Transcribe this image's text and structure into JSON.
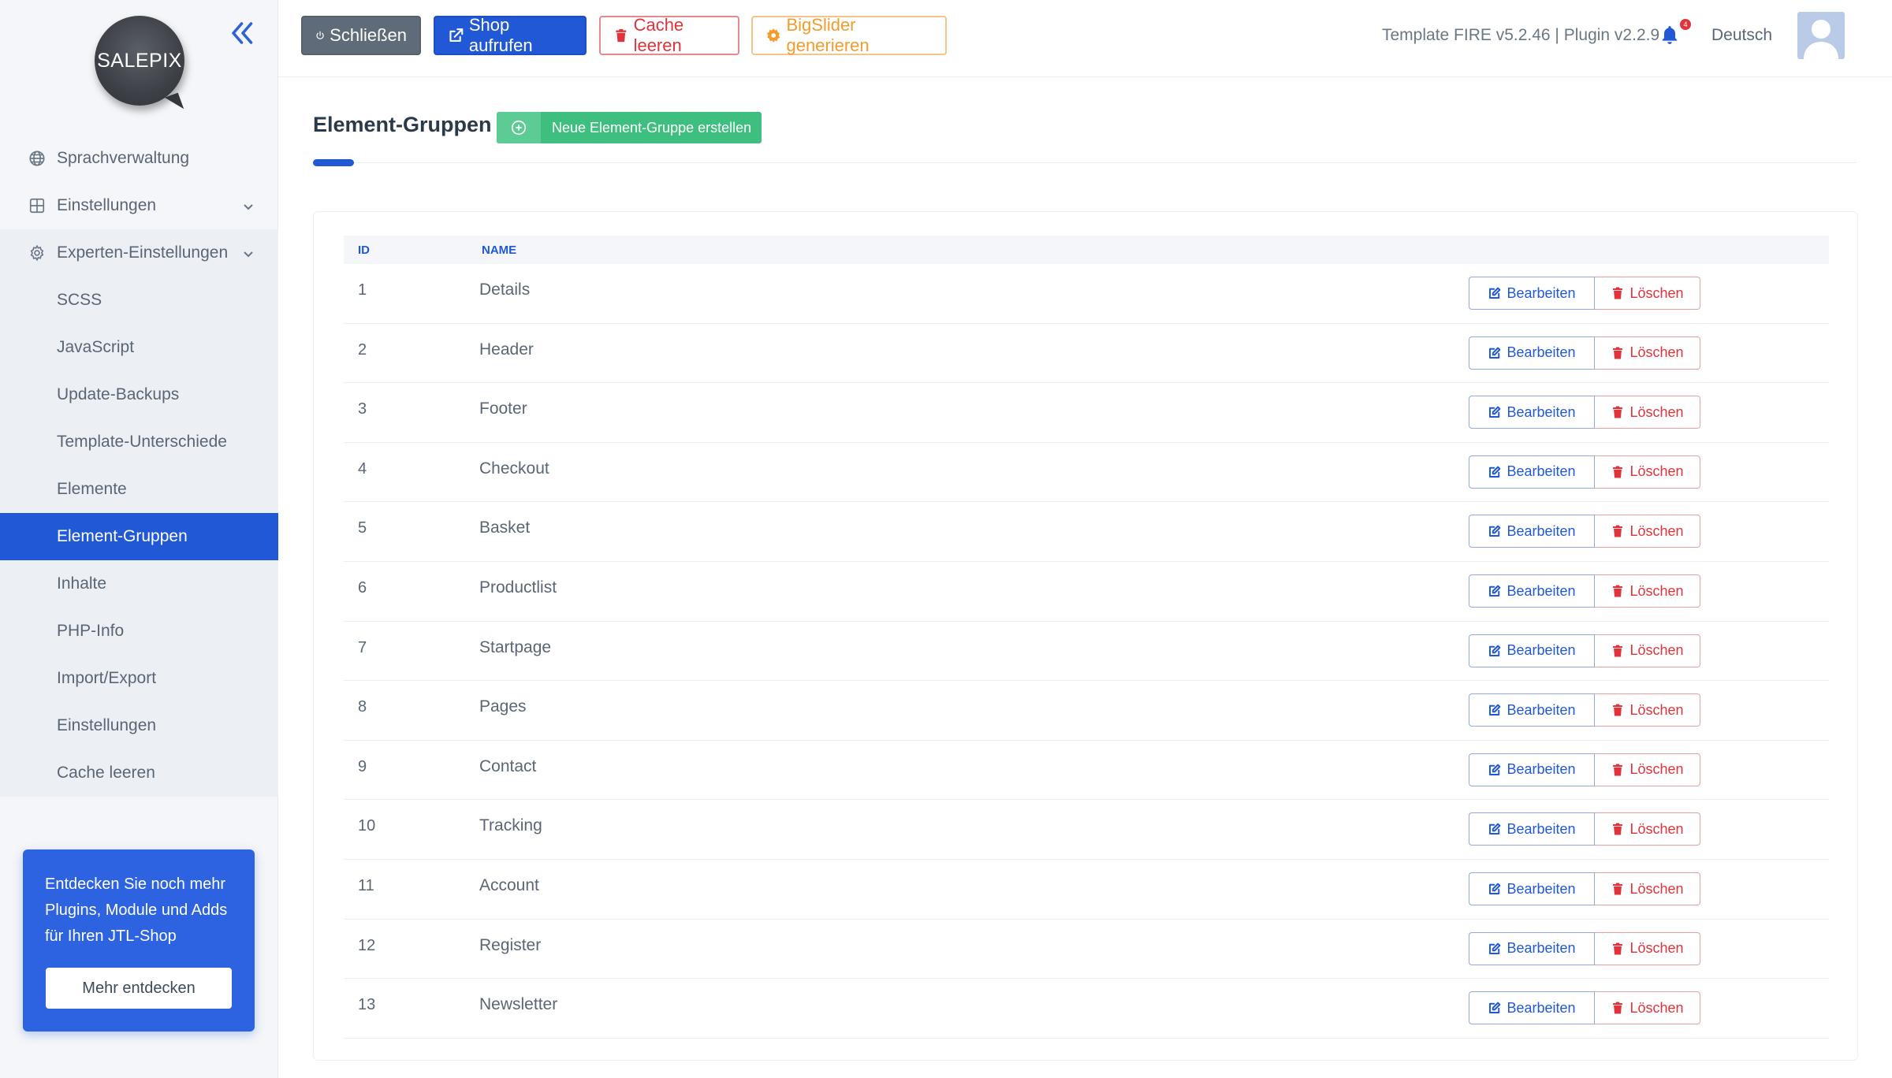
{
  "app": {
    "logo_text": "SALEPIX"
  },
  "sidebar": {
    "items": [
      {
        "label": "Sprachverwaltung",
        "icon": "globe-icon"
      },
      {
        "label": "Einstellungen",
        "icon": "grid-icon",
        "expandable": true
      },
      {
        "label": "Experten-Einstellungen",
        "icon": "gear-icon",
        "expandable": true,
        "expanded": true
      }
    ],
    "sub_items": [
      {
        "label": "SCSS"
      },
      {
        "label": "JavaScript"
      },
      {
        "label": "Update-Backups"
      },
      {
        "label": "Template-Unterschiede"
      },
      {
        "label": "Elemente"
      },
      {
        "label": "Element-Gruppen",
        "active": true
      },
      {
        "label": "Inhalte"
      },
      {
        "label": "PHP-Info"
      },
      {
        "label": "Import/Export"
      },
      {
        "label": "Einstellungen"
      },
      {
        "label": "Cache leeren"
      }
    ]
  },
  "promo": {
    "text": "Entdecken Sie noch mehr Plugins, Module und Adds für Ihren JTL-Shop",
    "button_label": "Mehr entdecken"
  },
  "topbar": {
    "close_label": "Schließen",
    "shop_label": "Shop aufrufen",
    "cache_label": "Cache leeren",
    "slider_label": "BigSlider generieren",
    "version": "Template FIRE v5.2.46 | Plugin v2.2.9",
    "notification_count": "4",
    "language": "Deutsch"
  },
  "main": {
    "title": "Element-Gruppen",
    "new_button_label": "Neue Element-Gruppe erstellen",
    "table": {
      "columns": [
        "ID",
        "NAME"
      ],
      "edit_label": "Bearbeiten",
      "delete_label": "Löschen",
      "rows": [
        {
          "id": "1",
          "name": "Details"
        },
        {
          "id": "2",
          "name": "Header"
        },
        {
          "id": "3",
          "name": "Footer"
        },
        {
          "id": "4",
          "name": "Checkout"
        },
        {
          "id": "5",
          "name": "Basket"
        },
        {
          "id": "6",
          "name": "Productlist"
        },
        {
          "id": "7",
          "name": "Startpage"
        },
        {
          "id": "8",
          "name": "Pages"
        },
        {
          "id": "9",
          "name": "Contact"
        },
        {
          "id": "10",
          "name": "Tracking"
        },
        {
          "id": "11",
          "name": "Account"
        },
        {
          "id": "12",
          "name": "Register"
        },
        {
          "id": "13",
          "name": "Newsletter"
        }
      ]
    }
  },
  "colors": {
    "primary": "#2158d6",
    "success": "#3fbf7f",
    "danger": "#e0333b",
    "warning": "#f39c2b",
    "secondary": "#5f6b78"
  }
}
